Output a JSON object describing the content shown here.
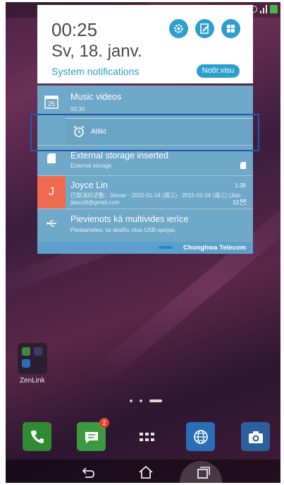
{
  "quick_settings": {
    "time": "00:25",
    "date": "Sv, 18. janv.",
    "system_notifications_label": "System notifications",
    "clear_all_label": "Notīr.visu"
  },
  "notifications": [
    {
      "title": "Music videos",
      "subtitle": "00:30",
      "icon": "calendar-icon",
      "icon_text": "25"
    },
    {
      "title": "External storage inserted",
      "subtitle": "External storage",
      "icon": "sd-card-icon"
    },
    {
      "title": "Joyce Lin",
      "subtitle": "已取消的活動：Dinner · 2015-01-14 (週三) · 2015-02-04 (週三) (Joic",
      "subtitle2": "jlasus9@gmail.com",
      "time": "1:39",
      "count": "13",
      "avatar_letter": "J",
      "icon": "avatar"
    },
    {
      "title": "Pievienots kā multivides ierīce",
      "subtitle": "Pieskarieties, lai skatītu citas USB opcijas.",
      "icon": "usb-icon"
    }
  ],
  "alarm_action": {
    "label": "Atlikt"
  },
  "carrier": "Chunghwa Telecom",
  "folder": {
    "label": "ZenLink"
  },
  "dock": {
    "messages_badge": "2"
  },
  "colors": {
    "accent": "#2e9fcd",
    "notification_bg": "#6fa8c8",
    "highlight": "#1f5aa8",
    "avatar_bg": "#ef6b4f"
  }
}
